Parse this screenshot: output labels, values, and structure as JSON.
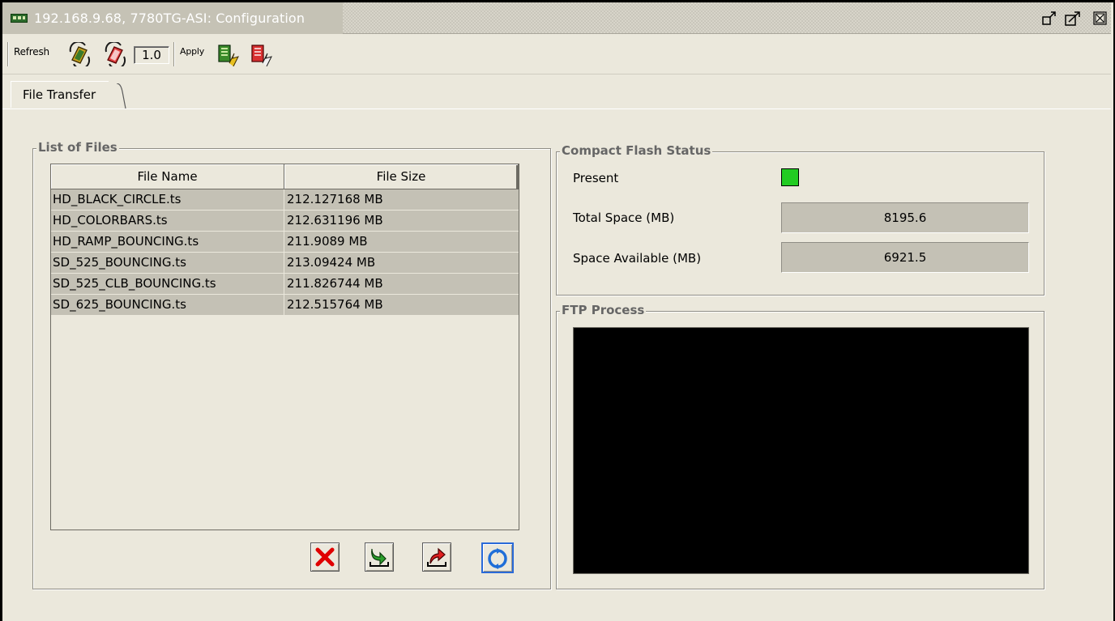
{
  "window": {
    "title": "192.168.9.68, 7780TG-ASI: Configuration",
    "icon": "app-board-icon"
  },
  "toolbar": {
    "refresh_label": "Refresh",
    "version_value": "1.0",
    "apply_label": "Apply"
  },
  "tabs": [
    {
      "label": "File Transfer",
      "selected": true
    }
  ],
  "list_of_files": {
    "title": "List of Files",
    "columns": [
      "File Name",
      "File Size"
    ],
    "rows": [
      {
        "name": "HD_BLACK_CIRCLE.ts",
        "size": "212.127168 MB"
      },
      {
        "name": "HD_COLORBARS.ts",
        "size": "212.631196 MB"
      },
      {
        "name": "HD_RAMP_BOUNCING.ts",
        "size": "211.9089 MB"
      },
      {
        "name": "SD_525_BOUNCING.ts",
        "size": "213.09424 MB"
      },
      {
        "name": "SD_525_CLB_BOUNCING.ts",
        "size": "211.826744 MB"
      },
      {
        "name": "SD_625_BOUNCING.ts",
        "size": "212.515764 MB"
      }
    ],
    "actions": [
      "delete-icon",
      "download-icon",
      "upload-icon",
      "refresh-icon"
    ]
  },
  "compact_flash": {
    "title": "Compact Flash Status",
    "present_label": "Present",
    "present_color": "#22cc22",
    "total_label": "Total Space (MB)",
    "total_value": "8195.6",
    "available_label": "Space Available (MB)",
    "available_value": "6921.5"
  },
  "ftp": {
    "title": "FTP Process"
  },
  "colors": {
    "background": "#ebe8dc",
    "selected_row": "#c4c1b5",
    "console": "#000000"
  }
}
